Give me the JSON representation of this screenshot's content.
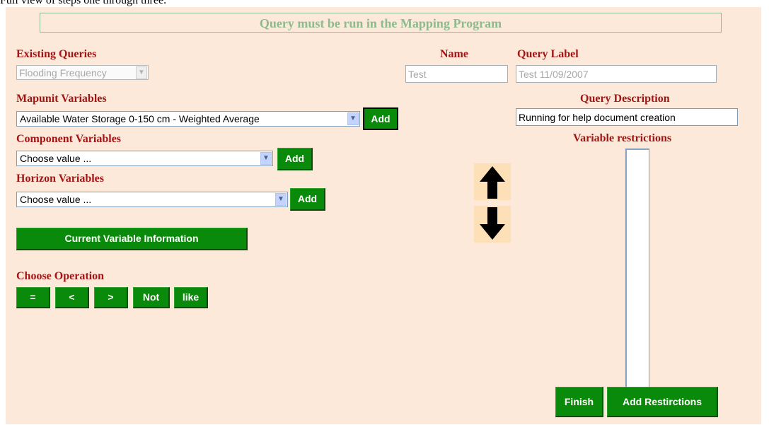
{
  "caption": "Full view of steps one through three.",
  "banner": "Query must be run in the Mapping Program",
  "existing_queries": {
    "label": "Existing Queries",
    "value": "Flooding Frequency"
  },
  "name": {
    "label": "Name",
    "value": "Test"
  },
  "query_label": {
    "label": "Query Label",
    "value": "Test 11/09/2007"
  },
  "mapunit": {
    "label": "Mapunit Variables",
    "value": "Available Water Storage 0-150 cm - Weighted Average",
    "add_label": "Add"
  },
  "component": {
    "label": "Component Variables",
    "value": "Choose value ...",
    "add_label": "Add"
  },
  "horizon": {
    "label": "Horizon Variables",
    "value": "Choose value ...",
    "add_label": "Add"
  },
  "current_info_label": "Current Variable Information",
  "operation": {
    "label": "Choose Operation",
    "ops": [
      "=",
      "<",
      ">",
      "Not",
      "like"
    ]
  },
  "query_description": {
    "label": "Query Description",
    "value": "Running for help document creation"
  },
  "variable_restrictions": {
    "label": "Variable restrictions"
  },
  "finish_label": "Finish",
  "add_restrictions_label": "Add Restirctions",
  "colors": {
    "panel": "#fde9d9",
    "label": "#a31515",
    "button": "#0a8a0a",
    "banner_text": "#8dbb8d"
  }
}
